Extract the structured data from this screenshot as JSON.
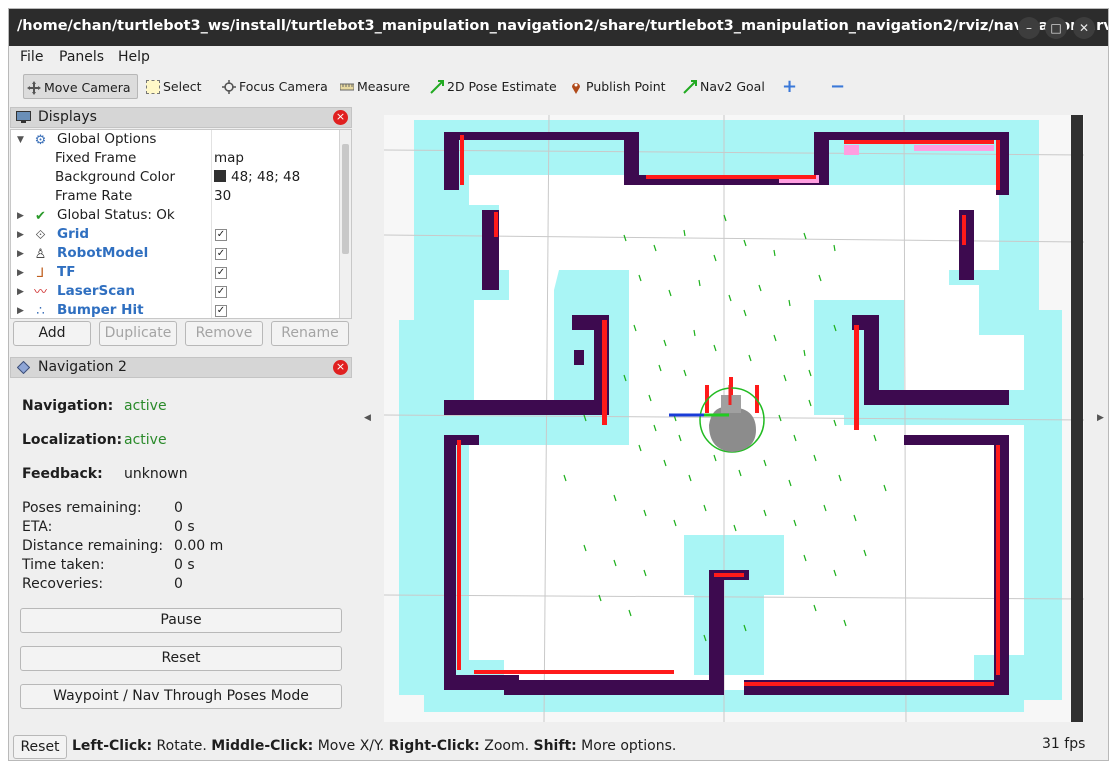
{
  "window": {
    "title": "/home/chan/turtlebot3_ws/install/turtlebot3_manipulation_navigation2/share/turtlebot3_manipulation_navigation2/rviz/navigation2.rv...",
    "minimize": "–",
    "maximize": "□",
    "close": "✕"
  },
  "menu": {
    "file": "File",
    "panels": "Panels",
    "help": "Help"
  },
  "toolbar": {
    "move_camera": "Move Camera",
    "select": "Select",
    "focus_camera": "Focus Camera",
    "measure": "Measure",
    "pose_estimate": "2D Pose Estimate",
    "publish_point": "Publish Point",
    "nav2_goal": "Nav2 Goal",
    "plus": "+",
    "minus": "−"
  },
  "displays": {
    "title": "Displays",
    "close": "×",
    "rows": {
      "global_options": "Global Options",
      "fixed_frame": "Fixed Frame",
      "fixed_frame_val": "map",
      "background_color": "Background Color",
      "background_color_val": "48; 48; 48",
      "frame_rate": "Frame Rate",
      "frame_rate_val": "30",
      "global_status": "Global Status: Ok",
      "grid": "Grid",
      "robot_model": "RobotModel",
      "tf": "TF",
      "laser_scan": "LaserScan",
      "bumper_hit": "Bumper Hit"
    },
    "check_mark": "✓",
    "buttons": {
      "add": "Add",
      "duplicate": "Duplicate",
      "remove": "Remove",
      "rename": "Rename"
    }
  },
  "navigation2": {
    "title": "Navigation 2",
    "close": "×",
    "navigation_label": "Navigation:",
    "navigation_value": "active",
    "localization_label": "Localization:",
    "localization_value": "active",
    "feedback_label": "Feedback:",
    "feedback_value": "unknown",
    "poses_remaining_label": "Poses remaining:",
    "poses_remaining_value": "0",
    "eta_label": "ETA:",
    "eta_value": "0 s",
    "distance_label": "Distance remaining:",
    "distance_value": "0.00 m",
    "time_label": "Time taken:",
    "time_value": "0 s",
    "recoveries_label": "Recoveries:",
    "recoveries_value": "0",
    "pause_button": "Pause",
    "reset_button": "Reset",
    "mode_button": "Waypoint / Nav Through Poses Mode"
  },
  "status": {
    "reset": "Reset",
    "left_click": "Left-Click:",
    "left_click_desc": " Rotate. ",
    "middle_click": "Middle-Click:",
    "middle_click_desc": " Move X/Y. ",
    "right_click": "Right-Click:",
    "right_click_desc": " Zoom. ",
    "shift": "Shift:",
    "shift_desc": " More options.",
    "fps": "31 fps"
  },
  "colors": {
    "wall": "#3d0a4f",
    "inflation": "#a9f5f5",
    "free": "#ffffff",
    "laser": "#ff0000",
    "particles": "#00c000"
  }
}
